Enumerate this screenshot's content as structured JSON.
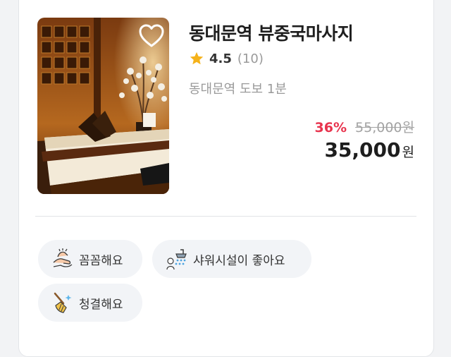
{
  "listing": {
    "name": "동대문역 뷰중국마사지",
    "rating": "4.5",
    "review_count": "(10)",
    "location": "동대문역 도보 1분",
    "discount": "36%",
    "original_price": "55,000원",
    "price": "35,000",
    "price_unit": "원",
    "favorite_icon": "heart-outline-icon",
    "rating_icon": "star-icon"
  },
  "tags": [
    {
      "label": "꼼꼼해요",
      "icon": "massage-hands-icon"
    },
    {
      "label": "샤워시설이 좋아요",
      "icon": "shower-icon"
    },
    {
      "label": "청결해요",
      "icon": "broom-icon"
    }
  ],
  "colors": {
    "discount": "#e8344e",
    "star": "#f5b21a",
    "tag_background": "#f2f4f7"
  }
}
